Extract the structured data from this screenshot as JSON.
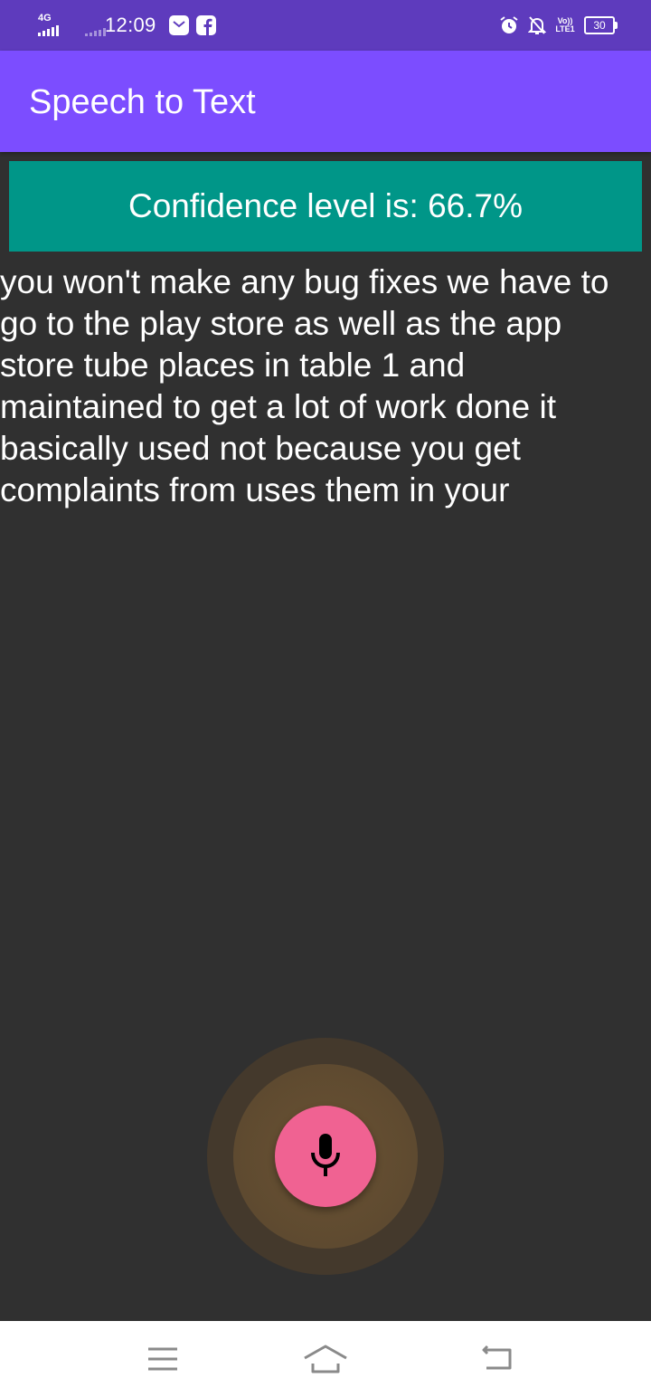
{
  "status_bar": {
    "network_type": "4G",
    "time": "12:09",
    "icons": [
      "signal-icon",
      "signal-secondary-icon",
      "mail-icon",
      "facebook-icon",
      "alarm-icon",
      "notifications-off-icon",
      "volte-icon",
      "battery-icon"
    ],
    "volte_line1": "Vo))",
    "volte_line2": "LTE1",
    "battery_level": "30",
    "background_color": "#5e3bbd"
  },
  "app_bar": {
    "title": "Speech to Text",
    "background_color": "#7c4dff"
  },
  "confidence": {
    "text": "Confidence level is: 66.7%",
    "background_color": "#009688"
  },
  "transcript": {
    "text": "you won't make any bug fixes we have to\ngo to the play store as well as the app\nstore tube places in table 1 and\nmaintained to get a lot of work done it\nbasically used not because you get\ncomplaints from uses them in your"
  },
  "mic_button": {
    "icon": "microphone-icon",
    "state": "listening",
    "color": "#f06292"
  },
  "nav_bar": {
    "buttons": [
      {
        "icon": "menu-icon"
      },
      {
        "icon": "home-icon"
      },
      {
        "icon": "back-icon"
      }
    ]
  }
}
